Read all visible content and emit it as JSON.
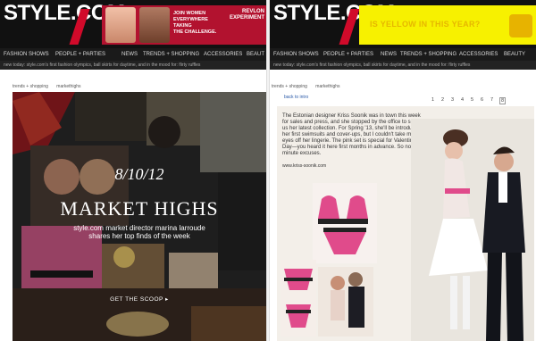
{
  "left": {
    "logo": {
      "text": "STYLE.COM"
    },
    "ad": {
      "line1": "JOIN WOMEN",
      "line2": "EVERYWHERE TAKING",
      "line3": "THE CHALLENGE.",
      "brand": "REVLON EXPERIMENT"
    },
    "nav": [
      "FASHION SHOWS",
      "PEOPLE + PARTIES",
      "NEWS",
      "TRENDS + SHOPPING",
      "ACCESSORIES",
      "BEAUT"
    ],
    "subnav_text": "new today: style.com's first fashion olympics, ball skirts for daytime, and in the mood for: flirty ruffles",
    "breadcrumb": [
      "trends + shopping",
      "markethighs"
    ],
    "feature": {
      "date": "8/10/12",
      "title": "MARKET HIGHS",
      "desc": "style.com market director marina larroude shares her top finds of the week",
      "cta": "GET THE SCOOP ▸"
    }
  },
  "right": {
    "logo": {
      "text": "STYLE.COM"
    },
    "ad": {
      "question": "IS YELLOW IN THIS YEAR?"
    },
    "nav": [
      "FASHION SHOWS",
      "PEOPLE + PARTIES",
      "NEWS",
      "TRENDS + SHOPPING",
      "ACCESSORIES",
      "BEAUTY"
    ],
    "subnav_text": "new today: style.com's first fashion olympics, ball skirts for daytime, and in the mood for: flirty ruffles",
    "breadcrumb": [
      "trends + shopping",
      "markethighs"
    ],
    "back_link": "back to intro",
    "pages": [
      "1",
      "2",
      "3",
      "4",
      "5",
      "6",
      "7",
      "8"
    ],
    "selected_page": "8",
    "article": {
      "paragraph": "The Estonian designer Kriss Soonik was in town this week for sales and press, and she stopped by the office to show us her latest collection. For Spring '13, she'll be introducing her first swimsuits and cover-ups, but I couldn't take my eyes off her lingerie. The pink set is special for Valentine's Day—you heard it here first months in advance. So no last-minute excuses.",
      "link": "www.kriss-soonik.com"
    }
  }
}
